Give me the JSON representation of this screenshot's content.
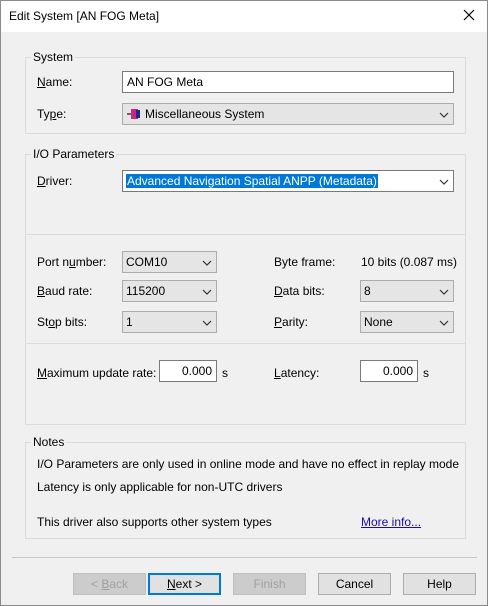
{
  "window": {
    "title": "Edit System [AN FOG Meta]"
  },
  "system": {
    "group_label": "System",
    "name_label": "Name:",
    "name_value": "AN FOG Meta",
    "type_label": "Type:",
    "type_value": "Miscellaneous System"
  },
  "io": {
    "group_label": "I/O Parameters",
    "driver_label": "Driver:",
    "driver_value": "Advanced Navigation Spatial ANPP (Metadata)",
    "port_label": "Port number:",
    "port_value": "COM10",
    "baud_label": "Baud rate:",
    "baud_value": "115200",
    "stop_label": "Stop bits:",
    "stop_value": "1",
    "byteframe_label": "Byte frame:",
    "byteframe_value": "10 bits (0.087 ms)",
    "databits_label": "Data bits:",
    "databits_value": "8",
    "parity_label": "Parity:",
    "parity_value": "None",
    "max_rate_label": "Maximum update rate:",
    "max_rate_value": "0.000",
    "max_rate_unit": "s",
    "latency_label": "Latency:",
    "latency_value": "0.000",
    "latency_unit": "s"
  },
  "notes": {
    "group_label": "Notes",
    "line1": "I/O Parameters are only used in online mode and have no effect in replay mode",
    "line2": "Latency is only applicable for non-UTC drivers",
    "line3": "This driver also supports other system types",
    "more_info": "More info..."
  },
  "buttons": {
    "back": "< Back",
    "next": "Next >",
    "finish": "Finish",
    "cancel": "Cancel",
    "help": "Help"
  },
  "icons": {
    "close": "close-icon",
    "type": "system-type-icon",
    "dropdown": "chevron-down-icon"
  },
  "colors": {
    "selection": "#0078d7",
    "link": "#1a0dab"
  }
}
